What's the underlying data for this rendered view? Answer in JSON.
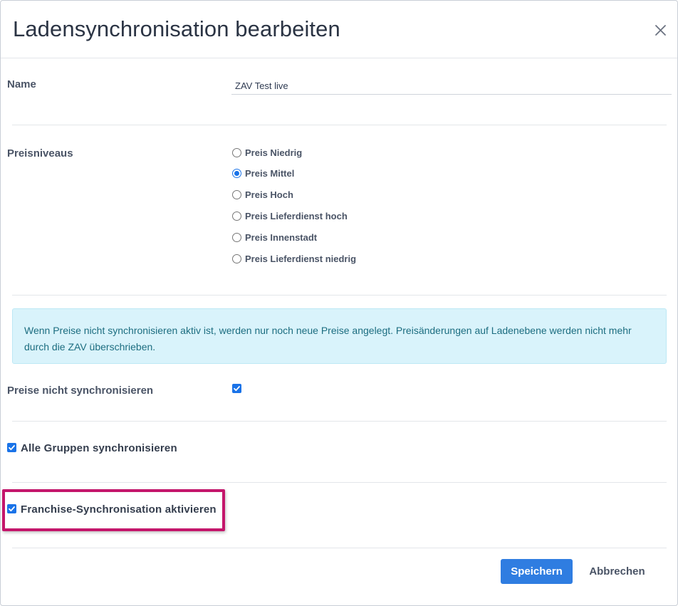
{
  "dialog": {
    "title": "Ladensynchronisation bearbeiten",
    "close_icon": "close-icon"
  },
  "name_field": {
    "label": "Name",
    "value": "ZAV Test live"
  },
  "price_levels": {
    "label": "Preisniveaus",
    "selected": "Preis Mittel",
    "options": [
      "Preis Niedrig",
      "Preis Mittel",
      "Preis Hoch",
      "Preis Lieferdienst hoch",
      "Preis Innenstadt",
      "Preis Lieferdienst niedrig"
    ]
  },
  "info_alert": {
    "text": "Wenn Preise nicht synchronisieren aktiv ist, werden nur noch neue Preise angelegt. Preisänderungen auf Ladenebene werden nicht mehr durch die ZAV überschrieben."
  },
  "options": {
    "no_price_sync": {
      "label": "Preise nicht synchronisieren",
      "checked": true
    },
    "sync_all_groups": {
      "label": "Alle Gruppen synchronisieren",
      "checked": true
    },
    "franchise_sync": {
      "label": "Franchise-Synchronisation aktivieren",
      "checked": true,
      "highlight_color": "#c4166b"
    }
  },
  "footer": {
    "save_label": "Speichern",
    "cancel_label": "Abbrechen"
  },
  "colors": {
    "primary": "#2f7de1",
    "checkbox": "#1a73e8",
    "alert_bg": "#d9f3fb",
    "alert_text": "#1c6d80"
  }
}
